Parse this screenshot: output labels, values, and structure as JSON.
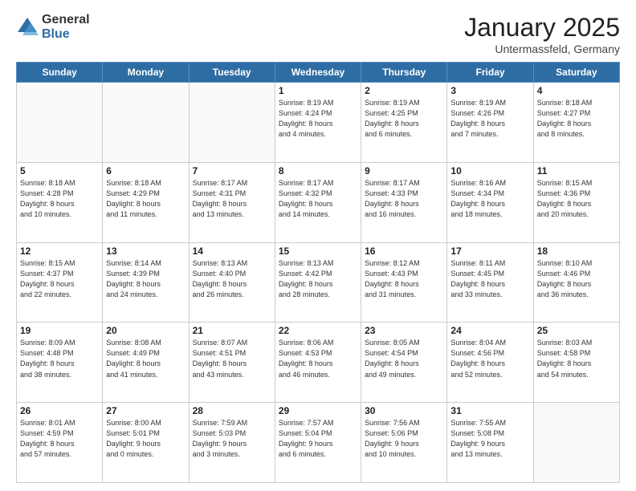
{
  "logo": {
    "general": "General",
    "blue": "Blue"
  },
  "header": {
    "month": "January 2025",
    "location": "Untermassfeld, Germany"
  },
  "weekdays": [
    "Sunday",
    "Monday",
    "Tuesday",
    "Wednesday",
    "Thursday",
    "Friday",
    "Saturday"
  ],
  "weeks": [
    [
      {
        "day": "",
        "info": ""
      },
      {
        "day": "",
        "info": ""
      },
      {
        "day": "",
        "info": ""
      },
      {
        "day": "1",
        "info": "Sunrise: 8:19 AM\nSunset: 4:24 PM\nDaylight: 8 hours\nand 4 minutes."
      },
      {
        "day": "2",
        "info": "Sunrise: 8:19 AM\nSunset: 4:25 PM\nDaylight: 8 hours\nand 6 minutes."
      },
      {
        "day": "3",
        "info": "Sunrise: 8:19 AM\nSunset: 4:26 PM\nDaylight: 8 hours\nand 7 minutes."
      },
      {
        "day": "4",
        "info": "Sunrise: 8:18 AM\nSunset: 4:27 PM\nDaylight: 8 hours\nand 8 minutes."
      }
    ],
    [
      {
        "day": "5",
        "info": "Sunrise: 8:18 AM\nSunset: 4:28 PM\nDaylight: 8 hours\nand 10 minutes."
      },
      {
        "day": "6",
        "info": "Sunrise: 8:18 AM\nSunset: 4:29 PM\nDaylight: 8 hours\nand 11 minutes."
      },
      {
        "day": "7",
        "info": "Sunrise: 8:17 AM\nSunset: 4:31 PM\nDaylight: 8 hours\nand 13 minutes."
      },
      {
        "day": "8",
        "info": "Sunrise: 8:17 AM\nSunset: 4:32 PM\nDaylight: 8 hours\nand 14 minutes."
      },
      {
        "day": "9",
        "info": "Sunrise: 8:17 AM\nSunset: 4:33 PM\nDaylight: 8 hours\nand 16 minutes."
      },
      {
        "day": "10",
        "info": "Sunrise: 8:16 AM\nSunset: 4:34 PM\nDaylight: 8 hours\nand 18 minutes."
      },
      {
        "day": "11",
        "info": "Sunrise: 8:15 AM\nSunset: 4:36 PM\nDaylight: 8 hours\nand 20 minutes."
      }
    ],
    [
      {
        "day": "12",
        "info": "Sunrise: 8:15 AM\nSunset: 4:37 PM\nDaylight: 8 hours\nand 22 minutes."
      },
      {
        "day": "13",
        "info": "Sunrise: 8:14 AM\nSunset: 4:39 PM\nDaylight: 8 hours\nand 24 minutes."
      },
      {
        "day": "14",
        "info": "Sunrise: 8:13 AM\nSunset: 4:40 PM\nDaylight: 8 hours\nand 26 minutes."
      },
      {
        "day": "15",
        "info": "Sunrise: 8:13 AM\nSunset: 4:42 PM\nDaylight: 8 hours\nand 28 minutes."
      },
      {
        "day": "16",
        "info": "Sunrise: 8:12 AM\nSunset: 4:43 PM\nDaylight: 8 hours\nand 31 minutes."
      },
      {
        "day": "17",
        "info": "Sunrise: 8:11 AM\nSunset: 4:45 PM\nDaylight: 8 hours\nand 33 minutes."
      },
      {
        "day": "18",
        "info": "Sunrise: 8:10 AM\nSunset: 4:46 PM\nDaylight: 8 hours\nand 36 minutes."
      }
    ],
    [
      {
        "day": "19",
        "info": "Sunrise: 8:09 AM\nSunset: 4:48 PM\nDaylight: 8 hours\nand 38 minutes."
      },
      {
        "day": "20",
        "info": "Sunrise: 8:08 AM\nSunset: 4:49 PM\nDaylight: 8 hours\nand 41 minutes."
      },
      {
        "day": "21",
        "info": "Sunrise: 8:07 AM\nSunset: 4:51 PM\nDaylight: 8 hours\nand 43 minutes."
      },
      {
        "day": "22",
        "info": "Sunrise: 8:06 AM\nSunset: 4:53 PM\nDaylight: 8 hours\nand 46 minutes."
      },
      {
        "day": "23",
        "info": "Sunrise: 8:05 AM\nSunset: 4:54 PM\nDaylight: 8 hours\nand 49 minutes."
      },
      {
        "day": "24",
        "info": "Sunrise: 8:04 AM\nSunset: 4:56 PM\nDaylight: 8 hours\nand 52 minutes."
      },
      {
        "day": "25",
        "info": "Sunrise: 8:03 AM\nSunset: 4:58 PM\nDaylight: 8 hours\nand 54 minutes."
      }
    ],
    [
      {
        "day": "26",
        "info": "Sunrise: 8:01 AM\nSunset: 4:59 PM\nDaylight: 8 hours\nand 57 minutes."
      },
      {
        "day": "27",
        "info": "Sunrise: 8:00 AM\nSunset: 5:01 PM\nDaylight: 9 hours\nand 0 minutes."
      },
      {
        "day": "28",
        "info": "Sunrise: 7:59 AM\nSunset: 5:03 PM\nDaylight: 9 hours\nand 3 minutes."
      },
      {
        "day": "29",
        "info": "Sunrise: 7:57 AM\nSunset: 5:04 PM\nDaylight: 9 hours\nand 6 minutes."
      },
      {
        "day": "30",
        "info": "Sunrise: 7:56 AM\nSunset: 5:06 PM\nDaylight: 9 hours\nand 10 minutes."
      },
      {
        "day": "31",
        "info": "Sunrise: 7:55 AM\nSunset: 5:08 PM\nDaylight: 9 hours\nand 13 minutes."
      },
      {
        "day": "",
        "info": ""
      }
    ]
  ]
}
